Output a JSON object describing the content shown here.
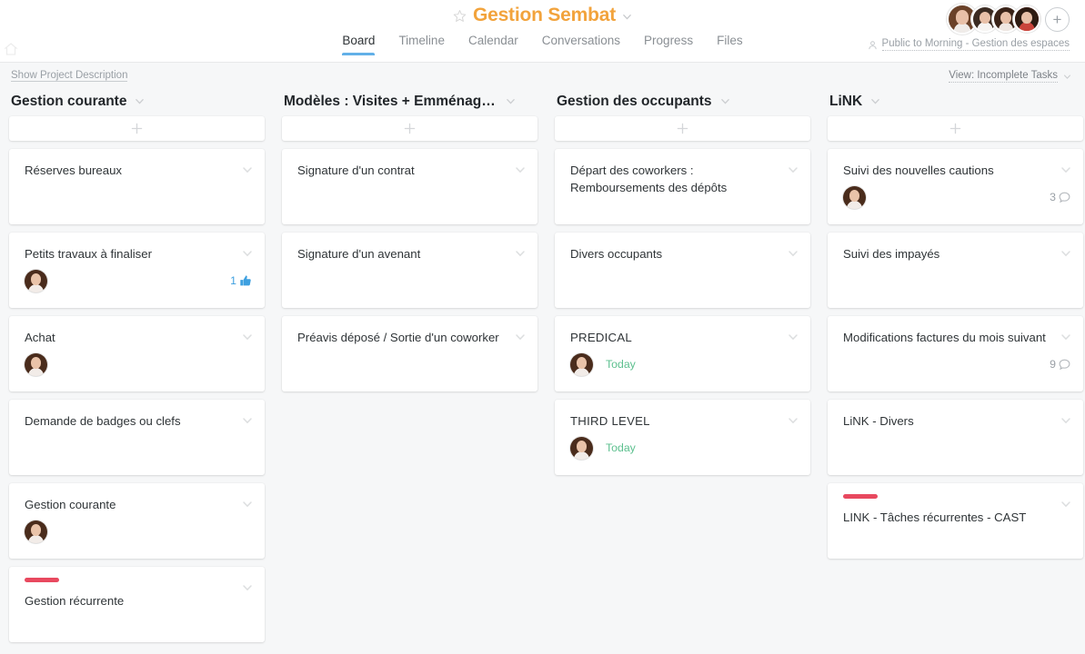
{
  "header": {
    "home_icon": "home-icon",
    "star_icon": "star-icon",
    "project_title": "Gestion Sembat",
    "title_caret_icon": "chevron-down-icon",
    "tabs": [
      {
        "label": "Board",
        "active": true
      },
      {
        "label": "Timeline",
        "active": false
      },
      {
        "label": "Calendar",
        "active": false
      },
      {
        "label": "Conversations",
        "active": false
      },
      {
        "label": "Progress",
        "active": false
      },
      {
        "label": "Files",
        "active": false
      }
    ],
    "members": [
      {
        "name": "member-avatar-1",
        "hair": "#6b4229",
        "bg": "#cfd6d9"
      },
      {
        "name": "member-avatar-2",
        "hair": "#3b2b22",
        "bg": "#e9e9e9"
      },
      {
        "name": "member-avatar-3",
        "hair": "#3a2318",
        "bg": "#d9d3cd"
      },
      {
        "name": "member-avatar-4",
        "hair": "#2d1b12",
        "bg": "#c9443b"
      }
    ],
    "add_member_label": "+",
    "privacy_icon": "people-icon",
    "privacy_label": "Public to Morning - Gestion des espaces"
  },
  "toolbar": {
    "show_description_label": "Show Project Description",
    "view_label": "View: Incomplete Tasks",
    "view_caret_icon": "chevron-down-icon"
  },
  "board": {
    "add_card_icon": "plus-icon",
    "column_caret_icon": "chevron-down-icon",
    "card_caret_icon": "chevron-down-icon",
    "comment_icon": "comment-bubble-icon",
    "like_icon": "thumbs-up-icon",
    "tag_color": "#e8495f",
    "due_color": "#5dc08f",
    "like_color": "#3ea0e0",
    "columns": [
      {
        "title": "Gestion courante",
        "cards": [
          {
            "title": "Réserves bureaux",
            "assignee": null,
            "due": null,
            "comments": null,
            "likes": null,
            "tag": false
          },
          {
            "title": "Petits travaux à finaliser",
            "assignee": "assignee-avatar",
            "due": null,
            "comments": null,
            "likes": "1",
            "tag": false
          },
          {
            "title": "Achat",
            "assignee": "assignee-avatar",
            "due": null,
            "comments": null,
            "likes": null,
            "tag": false
          },
          {
            "title": "Demande de badges ou clefs",
            "assignee": null,
            "due": null,
            "comments": null,
            "likes": null,
            "tag": false
          },
          {
            "title": "Gestion courante",
            "assignee": "assignee-avatar",
            "due": null,
            "comments": null,
            "likes": null,
            "tag": false
          },
          {
            "title": "Gestion récurrente",
            "assignee": null,
            "due": null,
            "comments": null,
            "likes": null,
            "tag": true
          }
        ]
      },
      {
        "title": "Modèles : Visites + Emménage…",
        "cards": [
          {
            "title": "Signature d'un contrat",
            "assignee": null,
            "due": null,
            "comments": null,
            "likes": null,
            "tag": false
          },
          {
            "title": "Signature d'un avenant",
            "assignee": null,
            "due": null,
            "comments": null,
            "likes": null,
            "tag": false
          },
          {
            "title": "Préavis déposé / Sortie d'un coworker",
            "assignee": null,
            "due": null,
            "comments": null,
            "likes": null,
            "tag": false
          }
        ]
      },
      {
        "title": "Gestion des occupants",
        "cards": [
          {
            "title": "Départ des coworkers : Remboursements des dépôts",
            "assignee": null,
            "due": null,
            "comments": null,
            "likes": null,
            "tag": false
          },
          {
            "title": "Divers occupants",
            "assignee": null,
            "due": null,
            "comments": null,
            "likes": null,
            "tag": false
          },
          {
            "title": "PREDICAL",
            "assignee": "assignee-avatar",
            "due": "Today",
            "comments": null,
            "likes": null,
            "tag": false
          },
          {
            "title": "THIRD LEVEL",
            "assignee": "assignee-avatar",
            "due": "Today",
            "comments": null,
            "likes": null,
            "tag": false
          }
        ]
      },
      {
        "title": "LiNK",
        "cards": [
          {
            "title": "Suivi des nouvelles cautions",
            "assignee": "assignee-avatar",
            "due": null,
            "comments": "3",
            "likes": null,
            "tag": false
          },
          {
            "title": "Suivi des impayés",
            "assignee": null,
            "due": null,
            "comments": null,
            "likes": null,
            "tag": false
          },
          {
            "title": "Modifications factures du mois suivant",
            "assignee": null,
            "due": null,
            "comments": "9",
            "likes": null,
            "tag": false
          },
          {
            "title": "LiNK - Divers",
            "assignee": null,
            "due": null,
            "comments": null,
            "likes": null,
            "tag": false
          },
          {
            "title": "LINK - Tâches récurrentes - CAST",
            "assignee": null,
            "due": null,
            "comments": null,
            "likes": null,
            "tag": true
          }
        ]
      }
    ]
  }
}
